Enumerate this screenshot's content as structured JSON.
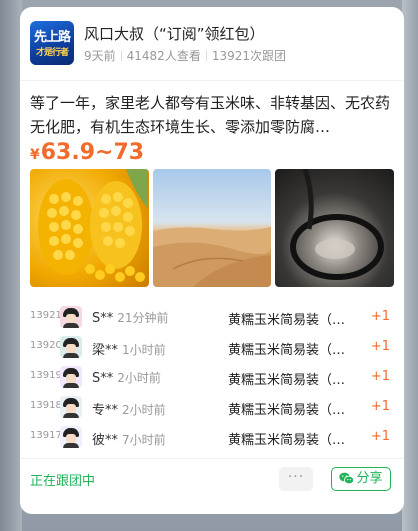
{
  "header": {
    "logo_text_1": "先上路",
    "logo_text_2": "才是行者",
    "title": "风口大叔（“订阅”领红包）",
    "posted": "9天前",
    "views": "41482人查看",
    "joins": "13921次跟团"
  },
  "product": {
    "description": "等了一年，家里老人都夸有玉米味、非转基因、无农药无化肥，有机生态环境生长、零添加零防腐…",
    "currency": "¥",
    "price_range": "63.9~73"
  },
  "images": [
    "corn-photo",
    "desert-photo",
    "pot-photo"
  ],
  "orders": [
    {
      "rank": "13921",
      "name": "S**",
      "time": "21分钟前",
      "item": "黄糯玉米简易装（…",
      "qty": "+1"
    },
    {
      "rank": "13920",
      "name": "梁**",
      "time": "1小时前",
      "item": "黄糯玉米简易装（…",
      "qty": "+1"
    },
    {
      "rank": "13919",
      "name": "S**",
      "time": "2小时前",
      "item": "黄糯玉米简易装（…",
      "qty": "+1"
    },
    {
      "rank": "13918",
      "name": "专**",
      "time": "2小时前",
      "item": "黄糯玉米简易装（…",
      "qty": "+1"
    },
    {
      "rank": "13917",
      "name": "彼**",
      "time": "7小时前",
      "item": "黄糯玉米简易装（…",
      "qty": "+1"
    }
  ],
  "footer": {
    "status": "正在跟团中",
    "more_label": "···",
    "share_label": "分享"
  },
  "colors": {
    "accent_orange": "#f06b2c",
    "accent_green": "#21b35a"
  }
}
